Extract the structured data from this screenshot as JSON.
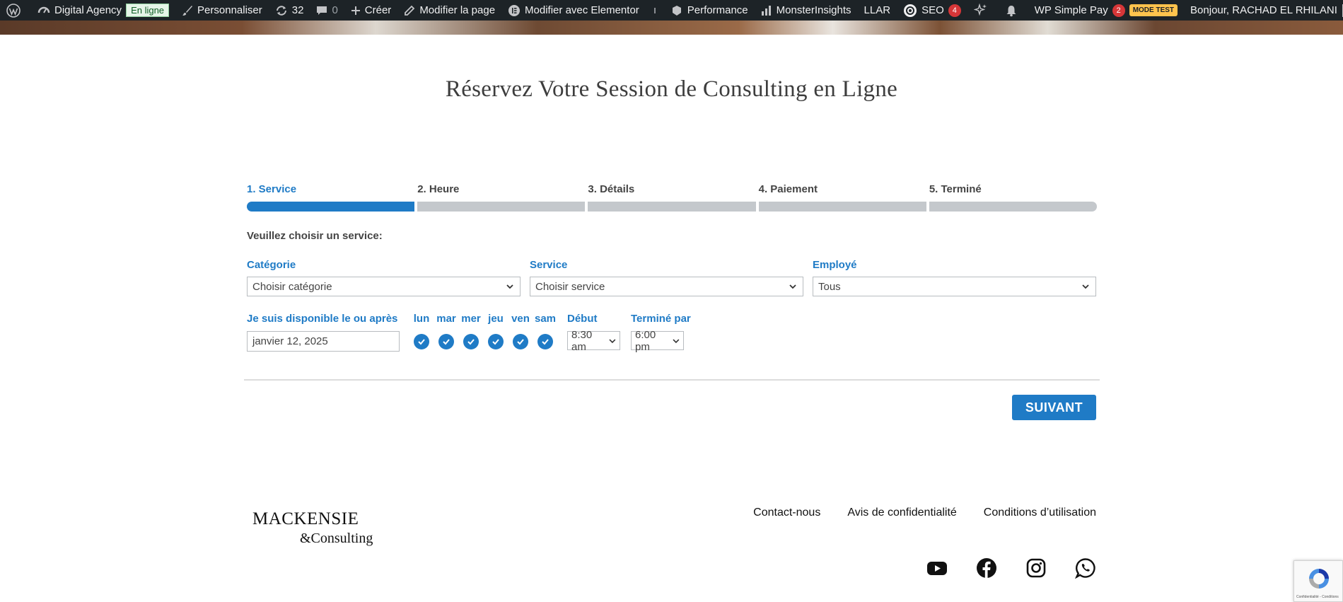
{
  "adminbar": {
    "site_name": "Digital Agency",
    "status_badge": "En ligne",
    "customize": "Personnaliser",
    "updates_count": "32",
    "comments_count": "0",
    "create": "Créer",
    "edit_page": "Modifier la page",
    "edit_elementor": "Modifier avec Elementor",
    "performance": "Performance",
    "monsterinsights": "MonsterInsights",
    "llar": "LLAR",
    "seo": "SEO",
    "seo_count": "4",
    "wp_simple_pay": "WP Simple Pay",
    "wp_simple_pay_count": "2",
    "mode_test": "MODE TEST",
    "greeting": "Bonjour, RACHAD EL RHILANI"
  },
  "page": {
    "title": "Réservez Votre Session de Consulting en Ligne"
  },
  "booking": {
    "steps": [
      {
        "label": "1. Service"
      },
      {
        "label": "2. Heure"
      },
      {
        "label": "3. Détails"
      },
      {
        "label": "4. Paiement"
      },
      {
        "label": "5. Terminé"
      }
    ],
    "active_step": 1,
    "prompt": "Veuillez choisir un service:",
    "category_label": "Catégorie",
    "category_value": "Choisir catégorie",
    "service_label": "Service",
    "service_value": "Choisir service",
    "employee_label": "Employé",
    "employee_value": "Tous",
    "date_label": "Je suis disponible le ou après",
    "date_value": "janvier 12, 2025",
    "days": [
      "lun",
      "mar",
      "mer",
      "jeu",
      "ven",
      "sam"
    ],
    "start_label": "Début",
    "start_value": "8:30 am",
    "end_label": "Terminé par",
    "end_value": "6:00 pm",
    "next_button": "SUIVANT"
  },
  "footer": {
    "logo_line1": "MACKENSIE",
    "logo_line2": "&Consulting",
    "links": [
      "Contact-nous",
      "Avis de confidentialité",
      "Conditions d’utilisation"
    ],
    "social_icons": [
      "youtube-icon",
      "facebook-icon",
      "instagram-icon",
      "whatsapp-icon"
    ]
  },
  "recaptcha": {
    "text": "Confidentialité - Conditions"
  },
  "colors": {
    "accent": "#1f7bc6",
    "adminbar": "#1d2327",
    "step_inactive": "#c4c8cc"
  }
}
